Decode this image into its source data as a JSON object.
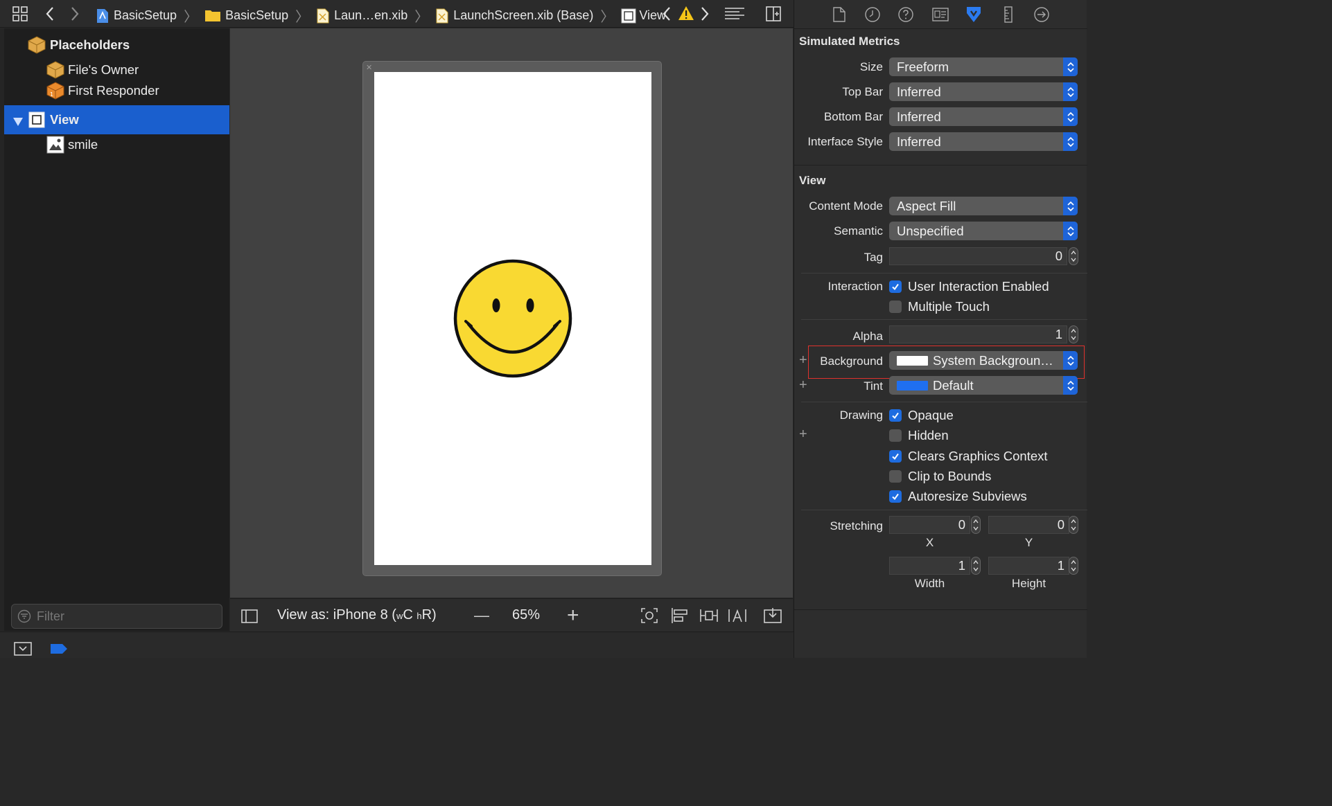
{
  "jumpbar": {
    "crumbs": [
      "BasicSetup",
      "BasicSetup",
      "Laun…en.xib",
      "LaunchScreen.xib (Base)",
      "View"
    ]
  },
  "outline": {
    "placeholders": "Placeholders",
    "files_owner": "File's Owner",
    "first_responder": "First Responder",
    "view": "View",
    "smile": "smile",
    "filter_placeholder": "Filter"
  },
  "canvas": {
    "view_as": "View as: iPhone 8 (",
    "size_w": "w",
    "size_c": "C",
    "size_h": "h",
    "size_r": "R)",
    "zoom": "65%",
    "zoom_minus": "—",
    "zoom_plus": "+"
  },
  "inspector": {
    "simulated_metrics": {
      "title": "Simulated Metrics",
      "size_label": "Size",
      "size_value": "Freeform",
      "top_bar_label": "Top Bar",
      "top_bar_value": "Inferred",
      "bottom_bar_label": "Bottom Bar",
      "bottom_bar_value": "Inferred",
      "interface_style_label": "Interface Style",
      "interface_style_value": "Inferred"
    },
    "view": {
      "title": "View",
      "content_mode_label": "Content Mode",
      "content_mode_value": "Aspect Fill",
      "semantic_label": "Semantic",
      "semantic_value": "Unspecified",
      "tag_label": "Tag",
      "tag_value": "0",
      "interaction_label": "Interaction",
      "user_interaction": "User Interaction Enabled",
      "multiple_touch": "Multiple Touch",
      "alpha_label": "Alpha",
      "alpha_value": "1",
      "background_label": "Background",
      "background_value": "System Backgroun…",
      "tint_label": "Tint",
      "tint_value": "Default",
      "drawing_label": "Drawing",
      "opaque": "Opaque",
      "hidden": "Hidden",
      "clears_graphics": "Clears Graphics Context",
      "clip_to_bounds": "Clip to Bounds",
      "autoresize": "Autoresize Subviews",
      "stretching_label": "Stretching",
      "stretch_x": "0",
      "stretch_y": "0",
      "stretch_x_label": "X",
      "stretch_y_label": "Y",
      "stretch_w": "1",
      "stretch_h": "1",
      "stretch_w_label": "Width",
      "stretch_h_label": "Height"
    }
  },
  "checkboxes": {
    "user_interaction": true,
    "multiple_touch": false,
    "opaque": true,
    "hidden": false,
    "clears_graphics": true,
    "clip_to_bounds": false,
    "autoresize": true
  },
  "colors": {
    "selection": "#1a5fce",
    "accent": "#1e64d8",
    "tint_swatch": "#1f6ff0",
    "background_swatch": "#ffffff",
    "smiley_face": "#f9d932",
    "highlight_box": "#e0322d"
  }
}
